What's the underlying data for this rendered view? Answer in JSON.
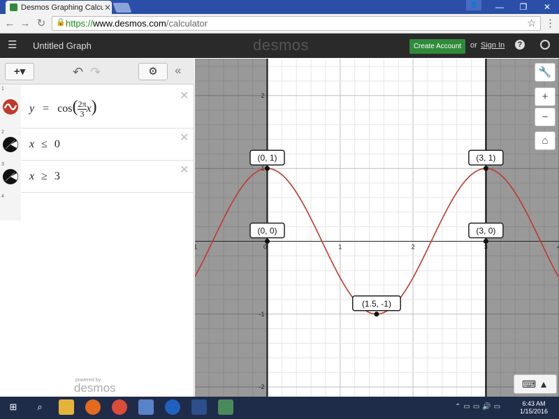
{
  "browser": {
    "tab_title": "Desmos Graphing Calculat",
    "url_scheme": "https://",
    "url_host": "www.desmos.com",
    "url_path": "/calculator"
  },
  "header": {
    "graph_title": "Untitled Graph",
    "logo": "desmos",
    "create_account": "Create Account",
    "or": "or",
    "sign_in": "Sign In"
  },
  "expressions": [
    {
      "num": "1",
      "icon": "wave-icon",
      "color": "#c0392b",
      "latex": "y = cos(2π/3 x)"
    },
    {
      "num": "2",
      "icon": "region-icon",
      "color": "#000000",
      "latex": "x ≤ 0"
    },
    {
      "num": "3",
      "icon": "region-icon",
      "color": "#000000",
      "latex": "x ≥ 3"
    },
    {
      "num": "4"
    }
  ],
  "expr_parts": {
    "e1_y": "y",
    "e1_eq": "=",
    "e1_cos": "cos",
    "e1_num": "2π",
    "e1_den": "3",
    "e1_x": "x",
    "e2_x": "x",
    "e2_op": "≤",
    "e2_v": "0",
    "e3_x": "x",
    "e3_op": "≥",
    "e3_v": "3"
  },
  "powered_by": "powered by",
  "powered_logo": "desmos",
  "chart_data": {
    "type": "line",
    "series": [
      {
        "equation": "y = cos(2π/3 x)",
        "color": "#c0392b"
      }
    ],
    "shaded_regions": [
      {
        "inequality": "x ≤ 0",
        "color": "#000000"
      },
      {
        "inequality": "x ≥ 3",
        "color": "#000000"
      }
    ],
    "xlim": [
      -1,
      4
    ],
    "ylim": [
      -2,
      2
    ],
    "x_ticks": [
      "-1",
      "0",
      "1",
      "2",
      "3",
      "4"
    ],
    "y_ticks": [
      "2",
      "1",
      "-1",
      "-2"
    ],
    "grid": true,
    "points": [
      {
        "x": 0,
        "y": 1,
        "label": "(0, 1)"
      },
      {
        "x": 3,
        "y": 1,
        "label": "(3, 1)"
      },
      {
        "x": 0,
        "y": 0,
        "label": "(0, 0)"
      },
      {
        "x": 3,
        "y": 0,
        "label": "(3, 0)"
      },
      {
        "x": 1.5,
        "y": -1,
        "label": "(1.5, -1)"
      }
    ]
  },
  "taskbar": {
    "time": "6:43 AM",
    "date": "1/15/2016"
  }
}
